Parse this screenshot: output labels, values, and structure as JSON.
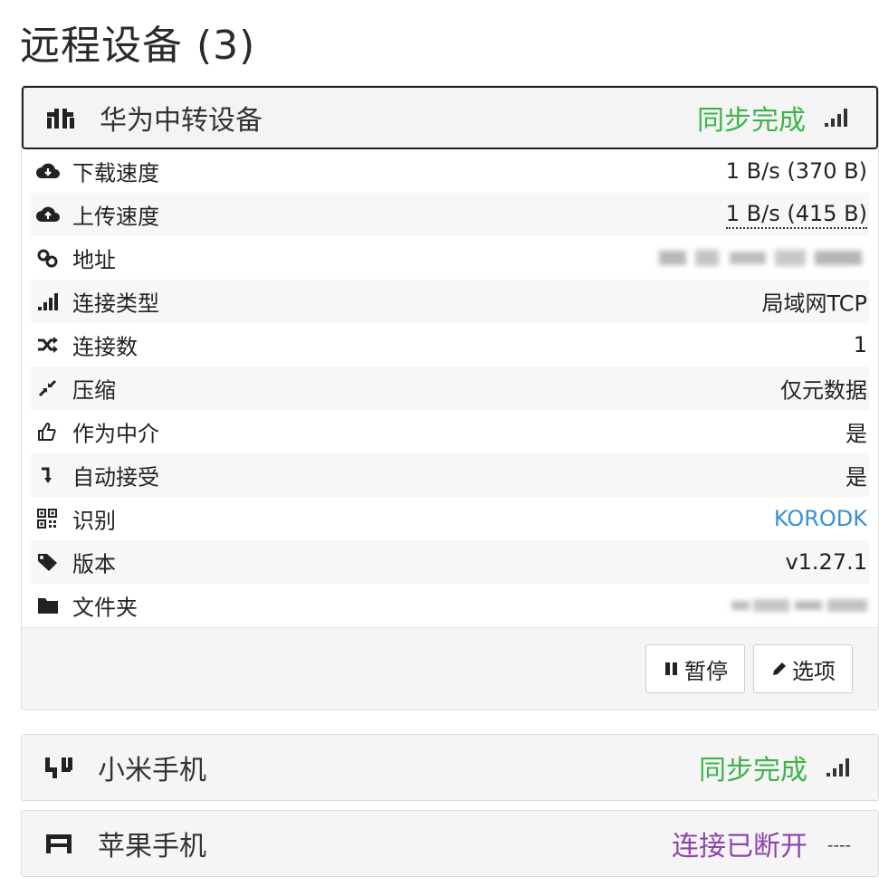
{
  "page": {
    "title": "远程设备 (3)"
  },
  "devices": [
    {
      "name": "华为中转设备",
      "status": "同步完成",
      "status_color": "#3db34a",
      "signal_icon": "signal-icon",
      "device_icon": "relay-device-icon",
      "details": [
        {
          "icon": "cloud-download-icon",
          "label": "下载速度",
          "value": "1 B/s (370 B)"
        },
        {
          "icon": "cloud-upload-icon",
          "label": "上传速度",
          "value": "1 B/s (415 B)"
        },
        {
          "icon": "link-icon",
          "label": "地址",
          "value": ""
        },
        {
          "icon": "signal-icon",
          "label": "连接类型",
          "value": "局域网TCP"
        },
        {
          "icon": "shuffle-icon",
          "label": "连接数",
          "value": "1"
        },
        {
          "icon": "compress-icon",
          "label": "压缩",
          "value": "仅元数据"
        },
        {
          "icon": "thumbs-up-icon",
          "label": "作为中介",
          "value": "是"
        },
        {
          "icon": "arrow-turn-down-icon",
          "label": "自动接受",
          "value": "是"
        },
        {
          "icon": "qrcode-icon",
          "label": "识别",
          "value": "KORODK"
        },
        {
          "icon": "tag-icon",
          "label": "版本",
          "value": "v1.27.1"
        },
        {
          "icon": "folder-icon",
          "label": "文件夹",
          "value": ""
        }
      ],
      "actions": {
        "pause_label": "暂停",
        "options_label": "选项"
      }
    },
    {
      "name": "小米手机",
      "status": "同步完成",
      "status_color": "#3db34a",
      "signal_icon": "signal-icon",
      "device_icon": "device-icon"
    },
    {
      "name": "苹果手机",
      "status": "连接已断开",
      "status_color": "#8e44ad",
      "signal_text": "----",
      "device_icon": "disconnected-device-icon"
    }
  ]
}
